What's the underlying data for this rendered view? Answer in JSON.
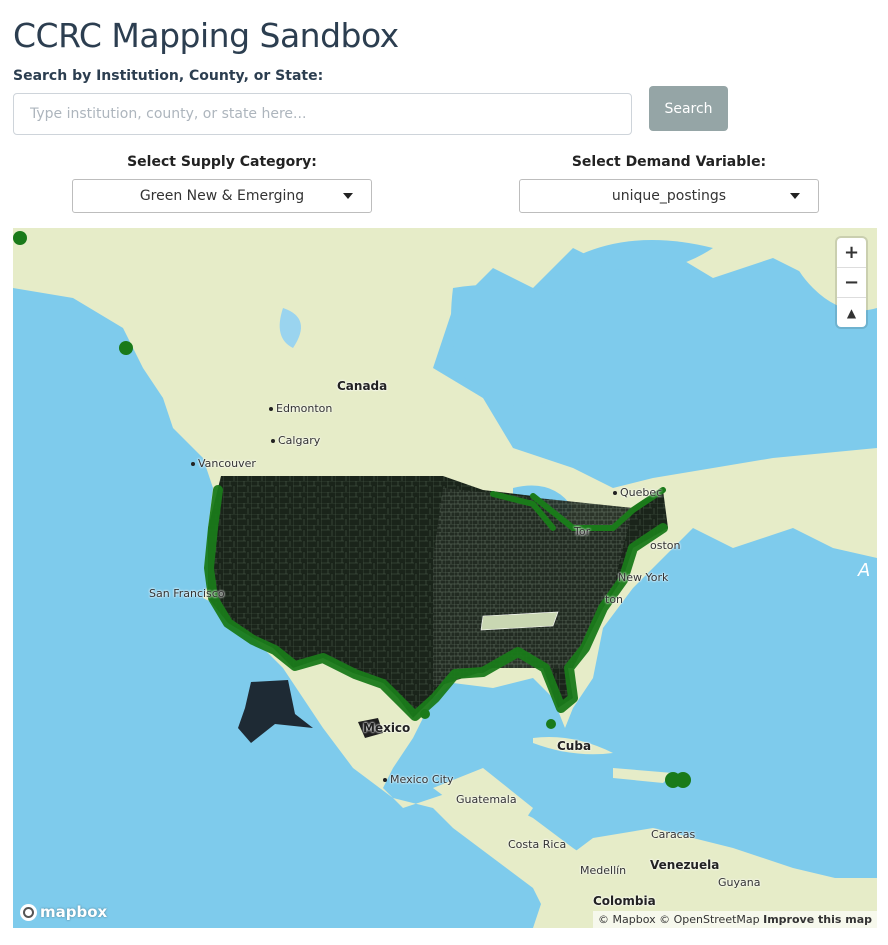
{
  "page": {
    "title": "CCRC Mapping Sandbox"
  },
  "search": {
    "label": "Search by Institution, County, or State:",
    "placeholder": "Type institution, county, or state here...",
    "value": "",
    "button_label": "Search"
  },
  "supply": {
    "label": "Select Supply Category:",
    "selected": "Green New & Emerging"
  },
  "demand": {
    "label": "Select Demand Variable:",
    "selected": "unique_postings"
  },
  "map": {
    "zoom_in": "+",
    "zoom_out": "−",
    "compass": "▲",
    "logo": "mapbox",
    "attribution_mapbox": "© Mapbox",
    "attribution_osm": "© OpenStreetMap",
    "attribution_improve": "Improve this map",
    "labels": {
      "canada": "Canada",
      "edmonton": "Edmonton",
      "calgary": "Calgary",
      "vancouver": "Vancouver",
      "quebec": "Quebec",
      "toronto": "Tor",
      "boston": "oston",
      "new_york": "New York",
      "washington": "ton",
      "san_francisco": "San Francisco",
      "mexico": "Mexico",
      "mexico_city": "Mexico City",
      "cuba": "Cuba",
      "guatemala": "Guatemala",
      "costa_rica": "Costa Rica",
      "caracas": "Caracas",
      "venezuela": "Venezuela",
      "medellin": "Medellín",
      "guyana": "Guyana",
      "colombia": "Colombia",
      "atlantic_fragment": "A"
    },
    "colors": {
      "water": "#7ecbec",
      "land": "#e8eec9",
      "counties": "#1e2a1e",
      "highlight_state": "#c8d8b0",
      "markers": "#1a7a1a"
    }
  }
}
